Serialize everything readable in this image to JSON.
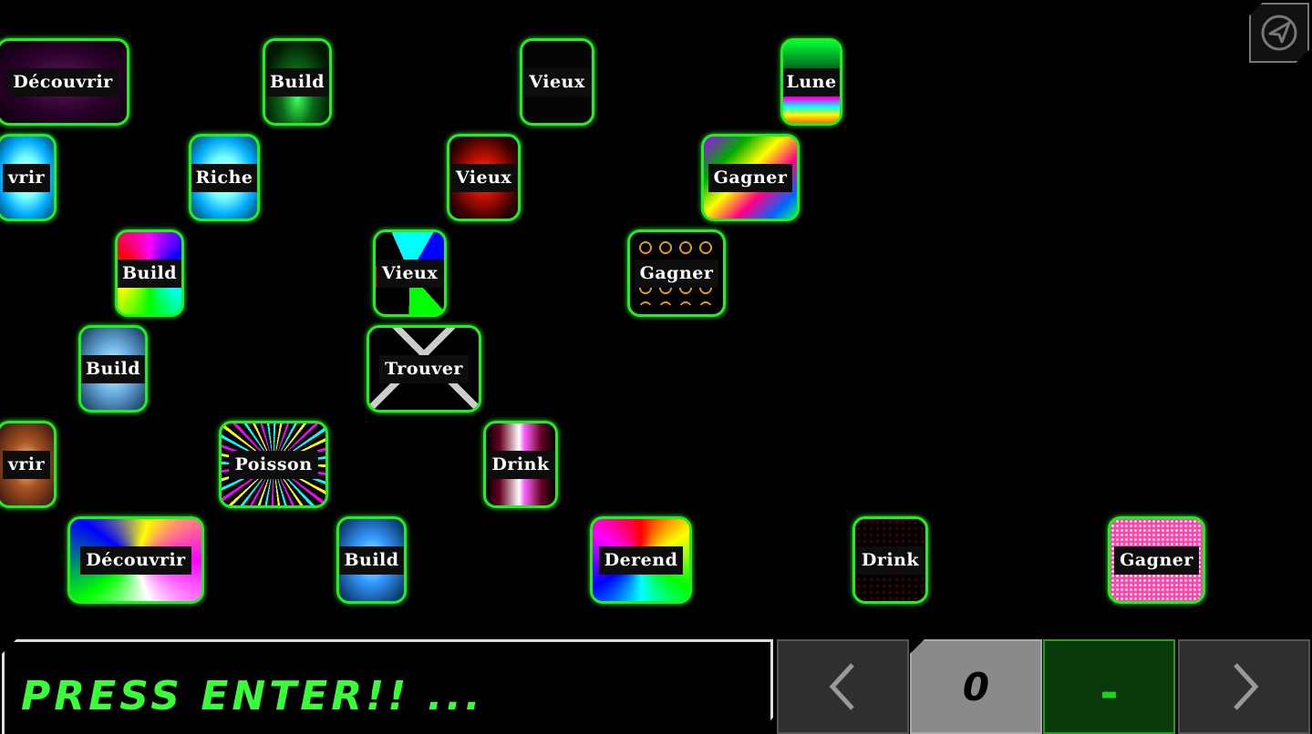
{
  "tiles": [
    {
      "label": "Découvrir",
      "style": "purple"
    },
    {
      "label": "Build",
      "style": "green-glow"
    },
    {
      "label": "Vieux",
      "style": "black"
    },
    {
      "label": "Lune",
      "style": "rainbow-bottom"
    },
    {
      "label": "vrir",
      "style": "ice"
    },
    {
      "label": "Riche",
      "style": "ice"
    },
    {
      "label": "Vieux",
      "style": "red-glow"
    },
    {
      "label": "Gagner",
      "style": "psychedelic"
    },
    {
      "label": "Build",
      "style": "tunnel"
    },
    {
      "label": "Vieux",
      "style": "shards"
    },
    {
      "label": "Gagner",
      "style": "rings"
    },
    {
      "label": "Build",
      "style": "cloud"
    },
    {
      "label": "Trouver",
      "style": "diamond"
    },
    {
      "label": "vrir",
      "style": "brown"
    },
    {
      "label": "Poisson",
      "style": "rays"
    },
    {
      "label": "Drink",
      "style": "pink-beam"
    },
    {
      "label": "Découvrir",
      "style": "swirl"
    },
    {
      "label": "Build",
      "style": "blue-smoke"
    },
    {
      "label": "Derend",
      "style": "tiedye"
    },
    {
      "label": "Drink",
      "style": "dots"
    },
    {
      "label": "Gagner",
      "style": "pink-noise"
    }
  ],
  "message": "PRESS ENTER!! ...",
  "controls": {
    "prev": "‹",
    "score": "0",
    "input": "-",
    "next": "›"
  },
  "icons": {
    "compass": "compass-icon",
    "prev": "chevron-left-icon",
    "next": "chevron-right-icon"
  }
}
